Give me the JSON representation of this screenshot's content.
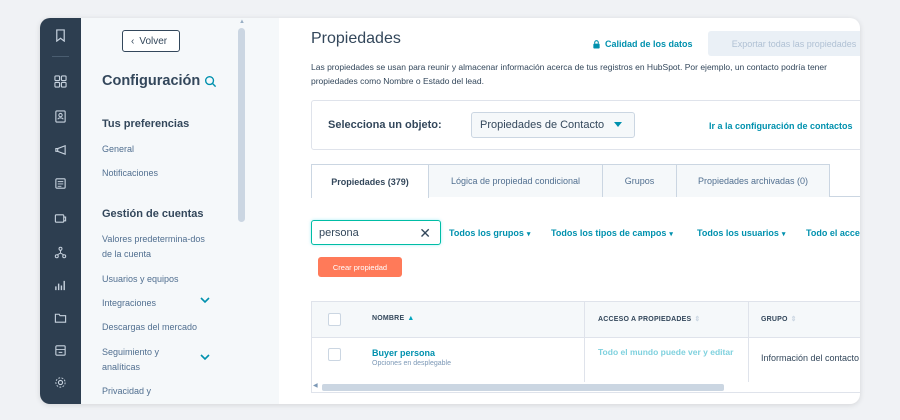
{
  "rail": {
    "icons": [
      "bookmark-icon",
      "grid-icon",
      "contacts-icon",
      "megaphone-icon",
      "sales-icon",
      "service-icon",
      "automation-icon",
      "reports-icon",
      "folder-icon",
      "library-icon",
      "settings-icon"
    ]
  },
  "sidebar": {
    "back_label": "Volver",
    "title": "Configuración",
    "section1": "Tus preferencias",
    "items1": [
      "General",
      "Notificaciones"
    ],
    "section2": "Gestión de cuentas",
    "items2": [
      "Valores predetermina-dos de la cuenta",
      "Usuarios y equipos",
      "Integraciones",
      "Descargas del mercado",
      "Seguimiento y analíticas",
      "Privacidad y"
    ]
  },
  "main": {
    "title": "Propiedades",
    "quality_link": "Calidad de los datos",
    "export_button": "Exportar todas las propiedades",
    "description": "Las propiedades se usan para reunir y almacenar información acerca de tus registros en HubSpot. Por ejemplo, un contacto podría tener propiedades como Nombre o Estado del lead.",
    "object_label": "Selecciona un objeto:",
    "object_value": "Propiedades de Contacto",
    "object_link": "Ir a la configuración de contactos",
    "tabs": [
      "Propiedades (379)",
      "Lógica de propiedad condicional",
      "Grupos",
      "Propiedades archivadas (0)"
    ],
    "search_value": "persona",
    "filters": [
      "Todos los grupos",
      "Todos los tipos de campos",
      "Todos los usuarios",
      "Todo el acceso"
    ],
    "create_button": "Crear propiedad",
    "table": {
      "headers": [
        "NOMBRE",
        "ACCESO A PROPIEDADES",
        "GRUPO"
      ],
      "rows": [
        {
          "name": "Buyer persona",
          "sub": "Opciones en desplegable",
          "access": "Todo el mundo puede ver y editar",
          "group": "Información del contacto"
        }
      ]
    }
  },
  "colors": {
    "rail": "#2d3e50",
    "accent": "#0091ae",
    "primary_button": "#ff7a59",
    "text": "#33475b"
  }
}
